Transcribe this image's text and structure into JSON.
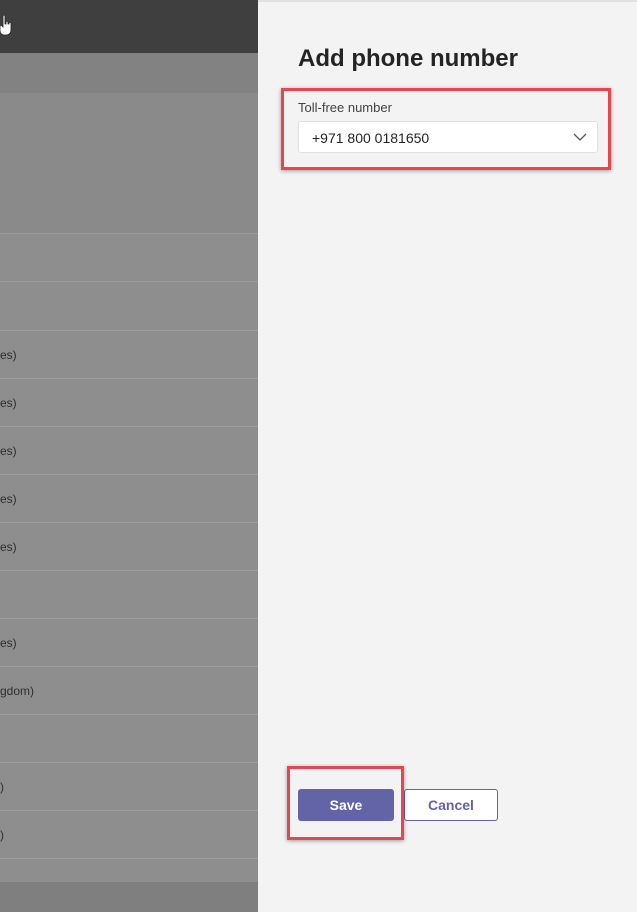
{
  "background_list": {
    "rows": [
      "es)",
      "es)",
      "es)",
      "es)",
      "es)",
      "",
      "es)",
      "gdom)",
      "",
      ")",
      ")"
    ]
  },
  "panel": {
    "title": "Add phone number",
    "field_label": "Toll-free number",
    "selected_value": "+971 800 0181650",
    "save_label": "Save",
    "cancel_label": "Cancel"
  },
  "colors": {
    "accent": "#6264a7",
    "highlight": "#e5474d"
  },
  "icons": [
    "hand-cursor-icon",
    "chevron-down-icon"
  ]
}
